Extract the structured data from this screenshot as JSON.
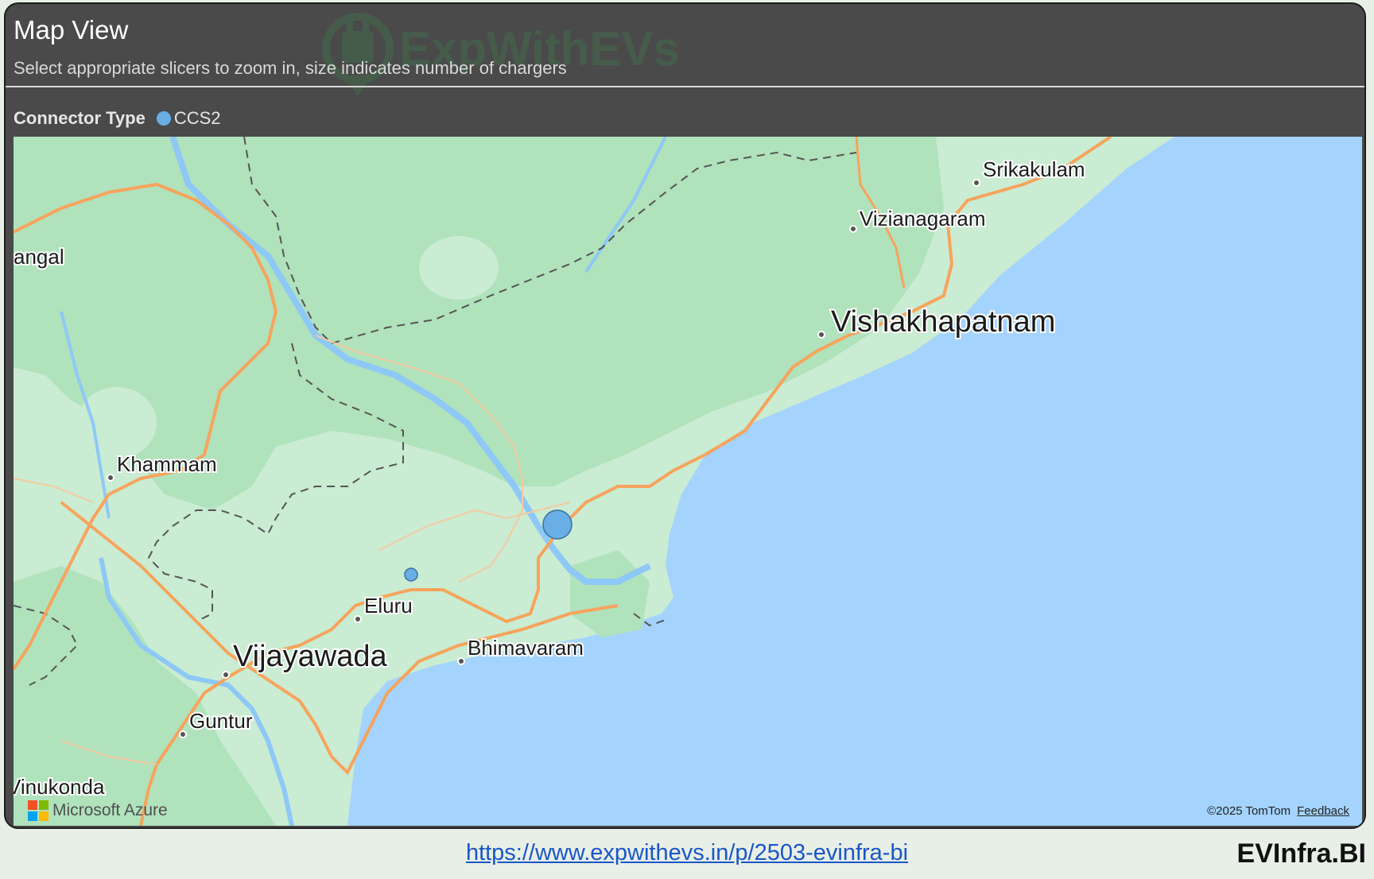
{
  "header": {
    "title": "Map View",
    "subtitle": "Select appropriate slicers to zoom in, size indicates number of chargers",
    "watermark": "ExpWithEVs"
  },
  "legend": {
    "title": "Connector Type",
    "items": [
      {
        "label": "CCS2",
        "color": "#6aaee6"
      }
    ]
  },
  "map": {
    "cities": [
      {
        "name": "Srikakulam",
        "size": "medium"
      },
      {
        "name": "Vizianagaram",
        "size": "medium"
      },
      {
        "name": "Vishakhapatnam",
        "size": "large"
      },
      {
        "name": "angal",
        "size": "medium"
      },
      {
        "name": "Khammam",
        "size": "medium"
      },
      {
        "name": "Eluru",
        "size": "medium"
      },
      {
        "name": "Vijayawada",
        "size": "large"
      },
      {
        "name": "Bhimavaram",
        "size": "medium"
      },
      {
        "name": "Guntur",
        "size": "medium"
      },
      {
        "name": "Vinukonda",
        "size": "medium"
      }
    ],
    "bubbles": [
      {
        "connector": "CCS2",
        "relative_size": "large"
      },
      {
        "connector": "CCS2",
        "relative_size": "small"
      }
    ],
    "colors": {
      "water": "#a4d3fd",
      "land": "#c9ecd2",
      "forest": "#b0e2bc",
      "road": "#f7a35c",
      "bubble": "#6aaee6"
    },
    "provider_logo": "Microsoft Azure",
    "attribution": "©2025 TomTom",
    "feedback": "Feedback"
  },
  "footer": {
    "url": "https://www.expwithevs.in/p/2503-evinfra-bi",
    "brand": "EVInfra.BI"
  }
}
